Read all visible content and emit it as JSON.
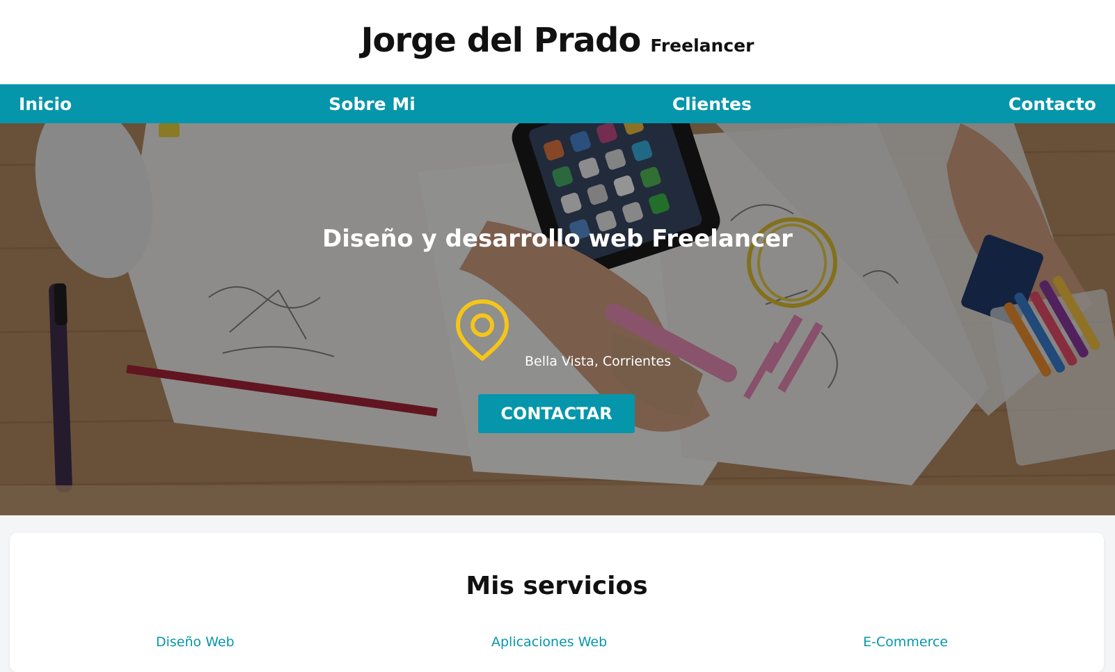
{
  "header": {
    "name": "Jorge del Prado",
    "tagline": "Freelancer"
  },
  "nav": {
    "items": [
      "Inicio",
      "Sobre Mi",
      "Clientes",
      "Contacto"
    ]
  },
  "hero": {
    "title": "Diseño y desarrollo web Freelancer",
    "location": "Bella Vista, Corrientes",
    "cta": "CONTACTAR"
  },
  "services": {
    "title": "Mis servicios",
    "items": [
      "Diseño Web",
      "Aplicaciones Web",
      "E-Commerce"
    ]
  },
  "colors": {
    "accent": "#0596ab",
    "pin": "#f5c518",
    "header_bg": "#ffffff"
  },
  "icons": {
    "location": "map-pin-icon"
  }
}
